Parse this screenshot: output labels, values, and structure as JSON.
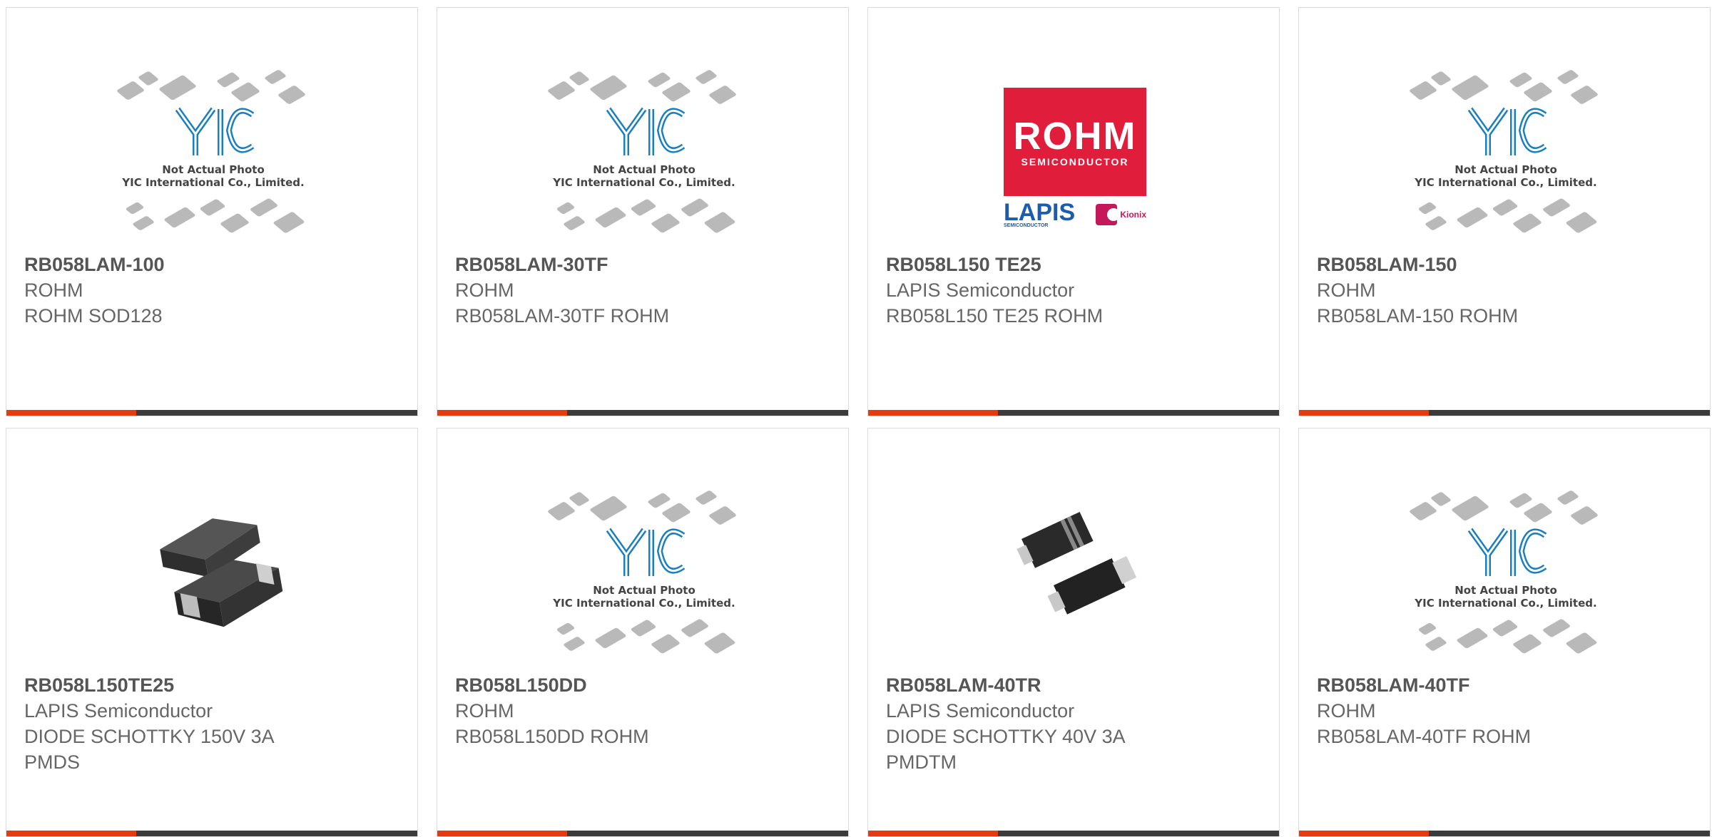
{
  "products": [
    {
      "part_number": "RB058LAM-100",
      "manufacturer": "ROHM",
      "description": "ROHM SOD128",
      "image": "placeholder"
    },
    {
      "part_number": "RB058LAM-30TF",
      "manufacturer": "ROHM",
      "description": "RB058LAM-30TF ROHM",
      "image": "placeholder"
    },
    {
      "part_number": "RB058L150 TE25",
      "manufacturer": "LAPIS Semiconductor",
      "description": "RB058L150 TE25 ROHM",
      "image": "rohm-logo"
    },
    {
      "part_number": "RB058LAM-150",
      "manufacturer": "ROHM",
      "description": "RB058LAM-150 ROHM",
      "image": "placeholder"
    },
    {
      "part_number": "RB058L150TE25",
      "manufacturer": "LAPIS Semiconductor",
      "description": "DIODE SCHOTTKY 150V 3A PMDS",
      "image": "diode-pmds-photo"
    },
    {
      "part_number": "RB058L150DD",
      "manufacturer": "ROHM",
      "description": "RB058L150DD ROHM",
      "image": "placeholder"
    },
    {
      "part_number": "RB058LAM-40TR",
      "manufacturer": "LAPIS Semiconductor",
      "description": "DIODE SCHOTTKY 40V 3A PMDTM",
      "image": "diode-pmdtm-photo"
    },
    {
      "part_number": "RB058LAM-40TF",
      "manufacturer": "ROHM",
      "description": "RB058LAM-40TF ROHM",
      "image": "placeholder"
    }
  ],
  "placeholder": {
    "line1": "Not Actual Photo",
    "line2": "YIC International Co., Limited."
  },
  "rohm_logo": {
    "brand": "ROHM",
    "tagline": "SEMICONDUCTOR",
    "lapis": "LAPIS",
    "lapis_sub": "SEMICONDUCTOR",
    "kionix": "Kionix"
  },
  "colors": {
    "accent": "#e53b0f",
    "bar": "#3b3b3b",
    "rohm_red": "#e01e3c",
    "yic_blue": "#1a7fc1"
  }
}
